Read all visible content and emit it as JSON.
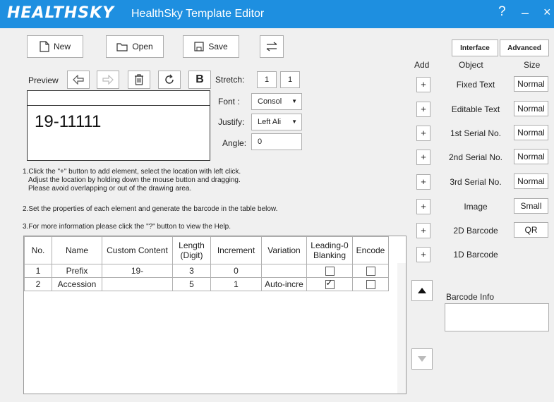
{
  "app": {
    "logo": "HEALTHSKY",
    "title": "HealthSky Template Editor",
    "help": "?",
    "minimize": "–",
    "close": "×"
  },
  "toolbar": {
    "new_label": "New",
    "open_label": "Open",
    "save_label": "Save"
  },
  "preview": {
    "label": "Preview",
    "bold": "B",
    "stretch_label": "Stretch:",
    "stretch_x": "1",
    "stretch_y": "1",
    "font_label": "Font :",
    "font_value": "Consol",
    "justify_label": "Justify:",
    "justify_value": "Left Ali",
    "angle_label": "Angle:",
    "angle_value": "0",
    "text": "19-11111"
  },
  "instructions": {
    "line1": "1.Click the \"+\" button to add element, select the location with left click.",
    "line2": "Adjust the location by holding down the mouse button and dragging.",
    "line3": "Please avoid overlapping or out of the drawing area.",
    "line4": "2.Set the properties of each element and generate the barcode in the table below.",
    "line5": "3.For more information please click the \"?\" button to view the Help."
  },
  "table": {
    "headers": {
      "no": "No.",
      "name": "Name",
      "custom": "Custom Content",
      "length1": "Length",
      "length2": "(Digit)",
      "increment": "Increment",
      "variation": "Variation",
      "lead1": "Leading-0",
      "lead2": "Blanking",
      "encode": "Encode"
    },
    "rows": [
      {
        "no": "1",
        "name": "Prefix",
        "custom": "19-",
        "length": "3",
        "increment": "0",
        "variation": "",
        "blanking": false,
        "encode": false
      },
      {
        "no": "2",
        "name": "Accession",
        "custom": "",
        "length": "5",
        "increment": "1",
        "variation": "Auto-incre",
        "blanking": true,
        "encode": false
      }
    ]
  },
  "right": {
    "interface_tab": "Interface",
    "advanced_tab": "Advanced",
    "add_header": "Add",
    "object_header": "Object",
    "size_header": "Size",
    "plus": "+",
    "objects": [
      {
        "name": "Fixed Text",
        "size": "Normal"
      },
      {
        "name": "Editable Text",
        "size": "Normal"
      },
      {
        "name": "1st Serial No.",
        "size": "Normal"
      },
      {
        "name": "2nd Serial No.",
        "size": "Normal"
      },
      {
        "name": "3rd Serial No.",
        "size": "Normal"
      },
      {
        "name": "Image",
        "size": "Small"
      },
      {
        "name": "2D Barcode",
        "size": "QR"
      },
      {
        "name": "1D Barcode",
        "size": ""
      }
    ],
    "barcode_info_label": "Barcode Info",
    "barcode_info_value": ""
  },
  "colors": {
    "titlebar": "#1e8fe0"
  }
}
